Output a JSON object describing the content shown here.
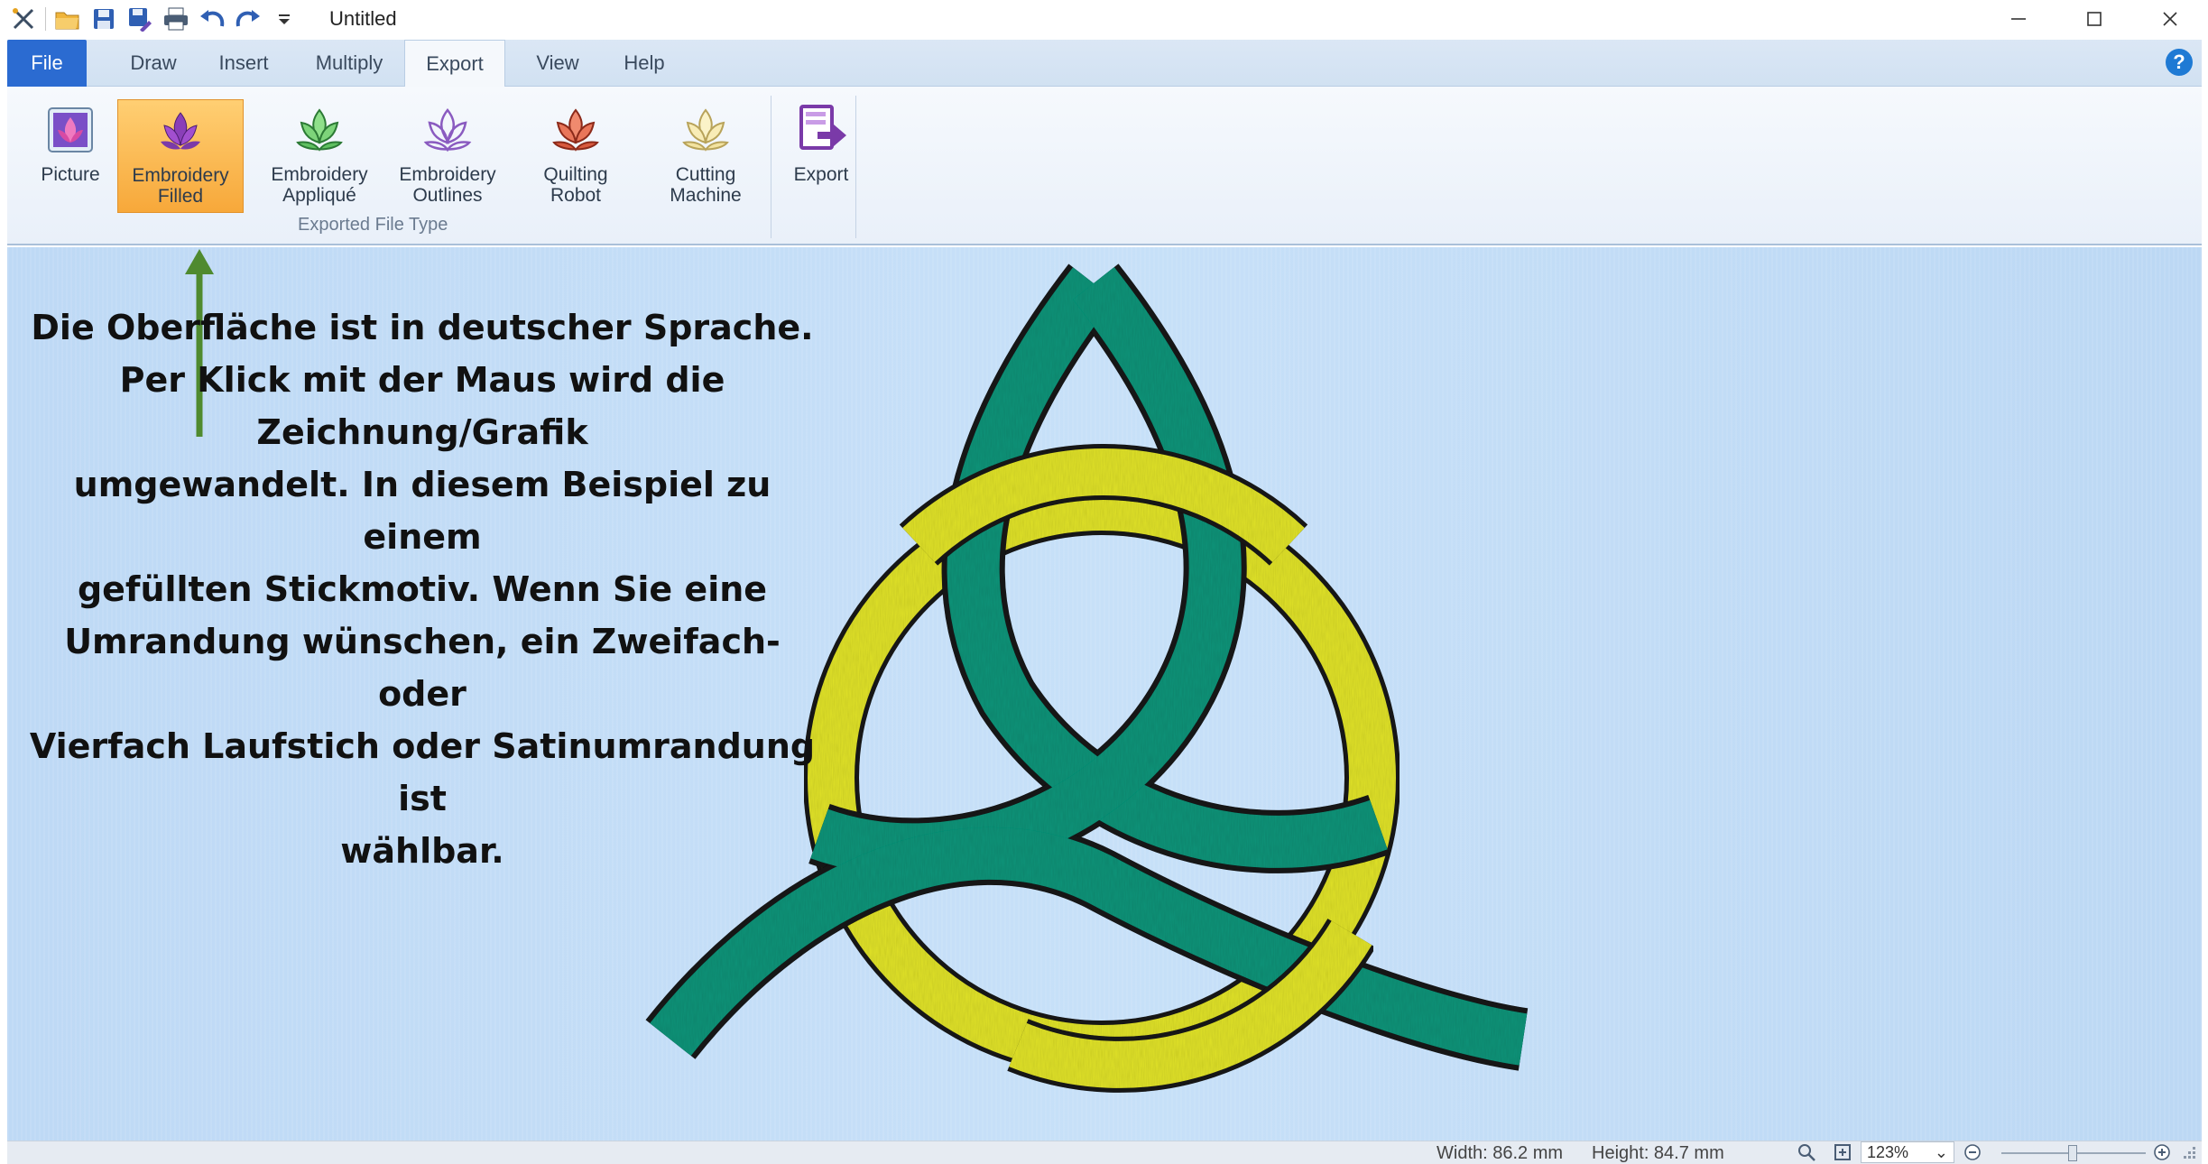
{
  "window": {
    "title": "Untitled"
  },
  "quick_access": [
    "tools-icon",
    "open-folder-icon",
    "save-icon",
    "save-as-icon",
    "print-icon",
    "undo-icon",
    "redo-icon",
    "customize-dropdown-icon"
  ],
  "tabs": [
    {
      "label": "File"
    },
    {
      "label": "Draw"
    },
    {
      "label": "Insert"
    },
    {
      "label": "Multiply"
    },
    {
      "label": "Export"
    },
    {
      "label": "View"
    },
    {
      "label": "Help"
    }
  ],
  "active_tab": "Export",
  "ribbon": {
    "buttons": [
      {
        "label_1": "Picture",
        "label_2": ""
      },
      {
        "label_1": "Embroidery",
        "label_2": "Filled"
      },
      {
        "label_1": "Embroidery",
        "label_2": "Appliqué"
      },
      {
        "label_1": "Embroidery",
        "label_2": "Outlines"
      },
      {
        "label_1": "Quilting",
        "label_2": "Robot"
      },
      {
        "label_1": "Cutting",
        "label_2": "Machine"
      },
      {
        "label_1": "Export",
        "label_2": ""
      }
    ],
    "selected_button": "Embroidery Filled",
    "group_label": "Exported File Type"
  },
  "annotation": {
    "lines": [
      "Die Oberfläche ist in deutscher Sprache.",
      "Per Klick mit der Maus wird die",
      "Zeichnung/Grafik",
      "umgewandelt. In diesem Beispiel zu einem",
      "gefüllten Stickmotiv. Wenn Sie eine",
      "Umrandung wünschen, ein Zweifach- oder",
      "Vierfach Laufstich oder Satinumrandung ist",
      "wählbar."
    ],
    "arrow_color": "#4f8a2f"
  },
  "status": {
    "width": "Width: 86.2 mm",
    "height": "Height: 84.7 mm",
    "zoom": "123%"
  },
  "colors": {
    "accent_file_tab": "#2b6bd1",
    "selected_button": "#f7a83a",
    "canvas_bg": "#c4ddf6",
    "motif_green": "#12957a",
    "motif_yellow": "#e2e42a",
    "motif_outline": "#1a1a1a"
  }
}
